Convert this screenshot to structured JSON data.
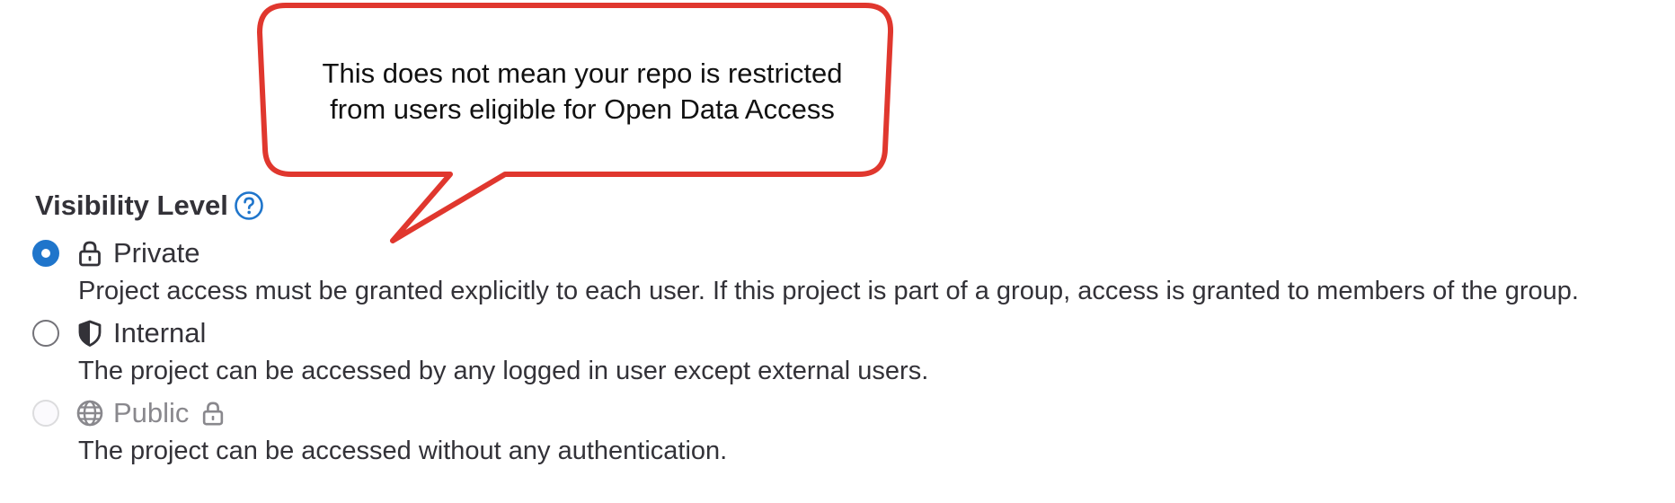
{
  "callout": {
    "line1": "This does not mean your repo is restricted",
    "line2": "from users eligible for Open Data Access",
    "border_color": "#e0372e"
  },
  "visibility": {
    "heading": "Visibility Level",
    "help_icon": "question-circle-icon",
    "accent_color": "#1f75cb",
    "options": [
      {
        "label": "Private",
        "icon": "lock-icon",
        "description": "Project access must be granted explicitly to each user. If this project is part of a group, access is granted to members of the group.",
        "selected": true,
        "disabled": false
      },
      {
        "label": "Internal",
        "icon": "shield-icon",
        "description": "The project can be accessed by any logged in user except external users.",
        "selected": false,
        "disabled": false
      },
      {
        "label": "Public",
        "icon": "globe-icon",
        "trailing_icon": "lock-icon",
        "description": "The project can be accessed without any authentication.",
        "selected": false,
        "disabled": true
      }
    ]
  }
}
